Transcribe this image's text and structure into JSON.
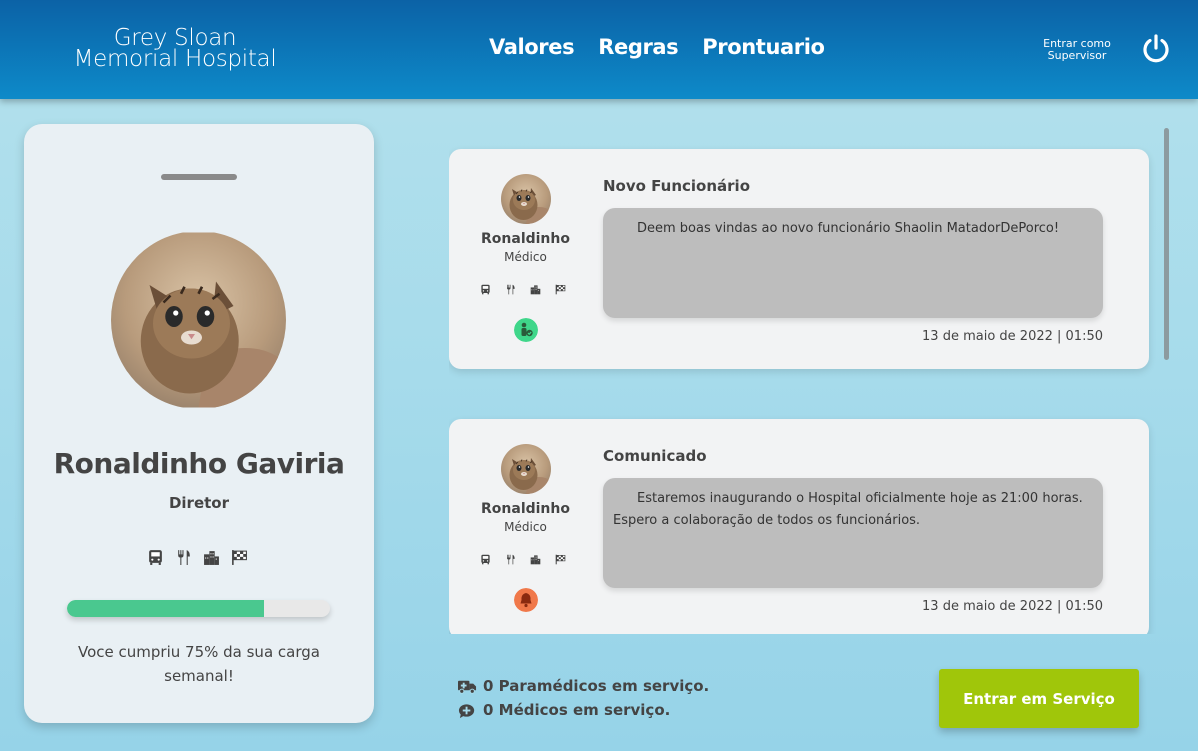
{
  "header": {
    "logo_line1": "Grey Sloan",
    "logo_line2": "Memorial Hospital",
    "nav": [
      "Valores",
      "Regras",
      "Prontuario"
    ],
    "supervisor_label": "Entrar como Supervisor",
    "power_icon": "power-icon"
  },
  "profile": {
    "name": "Ronaldinho Gaviria",
    "role": "Diretor",
    "icons": [
      "bus-icon",
      "utensils-icon",
      "city-icon",
      "checkered-flag-icon"
    ],
    "progress_percent": 75,
    "progress_text": "Voce cumpriu 75% da sua carga semanal!"
  },
  "posts": [
    {
      "author": "Ronaldinho",
      "role": "Médico",
      "title": "Novo Funcionário",
      "body": "Deem boas vindas ao novo funcionário Shaolin MatadorDePorco!",
      "date": "13 de maio de 2022 | 01:50",
      "badge": "new-user-icon",
      "badge_color": "#3fd68a"
    },
    {
      "author": "Ronaldinho",
      "role": "Médico",
      "title": "Comunicado",
      "body": "Estaremos inaugurando o Hospital oficialmente hoje as 21:00 horas.\nEspero a colaboração de todos os funcionários.",
      "date": "13 de maio de 2022 | 01:50",
      "badge": "bell-icon",
      "badge_color": "#f0784a"
    }
  ],
  "footer": {
    "paramedics": "0 Paramédicos em serviço.",
    "doctors": "0 Médicos em serviço.",
    "enter_button": "Entrar em Serviço"
  },
  "colors": {
    "header": "#0d7fc0",
    "progress": "#4ac88f",
    "button": "#a0c60a"
  }
}
